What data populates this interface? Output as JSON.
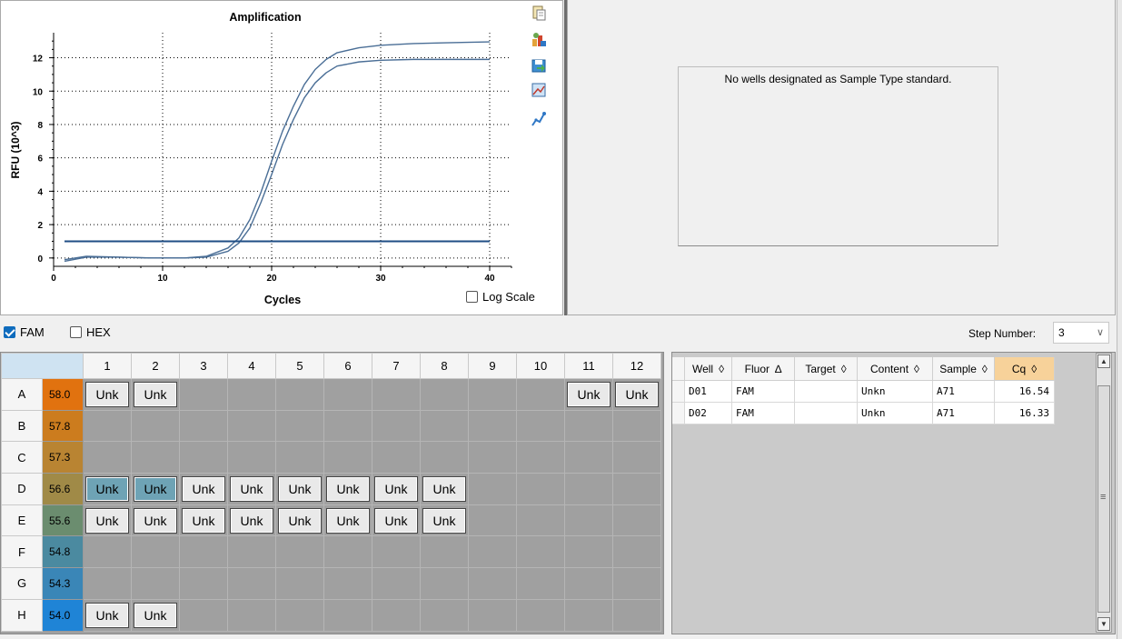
{
  "chart_data": {
    "type": "line",
    "title": "Amplification",
    "xlabel": "Cycles",
    "ylabel": "RFU (10^3)",
    "xlim": [
      0,
      42
    ],
    "ylim": [
      -0.5,
      13.5
    ],
    "xticks": [
      0,
      10,
      20,
      30,
      40
    ],
    "yticks": [
      0,
      2,
      4,
      6,
      8,
      10,
      12
    ],
    "grid": "dotted",
    "series": [
      {
        "values": [
          [
            1,
            -0.1
          ],
          [
            3,
            0.1
          ],
          [
            6,
            0.05
          ],
          [
            9,
            0.0
          ],
          [
            12,
            0.0
          ],
          [
            14,
            0.1
          ],
          [
            16,
            0.6
          ],
          [
            17,
            1.2
          ],
          [
            18,
            2.3
          ],
          [
            19,
            3.9
          ],
          [
            20,
            5.8
          ],
          [
            21,
            7.6
          ],
          [
            22,
            9.1
          ],
          [
            23,
            10.4
          ],
          [
            24,
            11.3
          ],
          [
            25,
            11.9
          ],
          [
            26,
            12.3
          ],
          [
            28,
            12.6
          ],
          [
            30,
            12.75
          ],
          [
            33,
            12.85
          ],
          [
            36,
            12.9
          ],
          [
            40,
            12.95
          ]
        ]
      },
      {
        "values": [
          [
            1,
            -0.2
          ],
          [
            3,
            0.05
          ],
          [
            6,
            0.05
          ],
          [
            9,
            0.0
          ],
          [
            12,
            0.0
          ],
          [
            14,
            0.05
          ],
          [
            16,
            0.4
          ],
          [
            17,
            0.9
          ],
          [
            18,
            1.8
          ],
          [
            19,
            3.3
          ],
          [
            20,
            5.0
          ],
          [
            21,
            6.8
          ],
          [
            22,
            8.3
          ],
          [
            23,
            9.6
          ],
          [
            24,
            10.5
          ],
          [
            25,
            11.1
          ],
          [
            26,
            11.5
          ],
          [
            28,
            11.75
          ],
          [
            30,
            11.85
          ],
          [
            33,
            11.9
          ],
          [
            36,
            11.9
          ],
          [
            40,
            11.9
          ]
        ]
      },
      {
        "values": [
          [
            1,
            1.0
          ],
          [
            40,
            1.0
          ]
        ]
      }
    ],
    "colors": {
      "curves": "#4a6e96",
      "threshold": "#1f4e85"
    }
  },
  "log_scale_label": "Log Scale",
  "standard_message": "No wells designated as Sample Type standard.",
  "fluors": [
    {
      "label": "FAM",
      "checked": true
    },
    {
      "label": "HEX",
      "checked": false
    }
  ],
  "step": {
    "label": "Step Number:",
    "value": "3"
  },
  "plate": {
    "columns": [
      "1",
      "2",
      "3",
      "4",
      "5",
      "6",
      "7",
      "8",
      "9",
      "10",
      "11",
      "12"
    ],
    "rows": [
      {
        "label": "A",
        "temp": "58.0",
        "color": "#e1720f",
        "wells": {
          "1": "Unk",
          "2": "Unk",
          "11": "Unk",
          "12": "Unk"
        }
      },
      {
        "label": "B",
        "temp": "57.8",
        "color": "#cc7c1e",
        "wells": {}
      },
      {
        "label": "C",
        "temp": "57.3",
        "color": "#b98432",
        "wells": {}
      },
      {
        "label": "D",
        "temp": "56.6",
        "color": "#a08a47",
        "wells": {
          "1": "Unk",
          "2": "Unk",
          "3": "Unk",
          "4": "Unk",
          "5": "Unk",
          "6": "Unk",
          "7": "Unk",
          "8": "Unk"
        },
        "selected": [
          "1",
          "2"
        ]
      },
      {
        "label": "E",
        "temp": "55.6",
        "color": "#6b8d6f",
        "wells": {
          "1": "Unk",
          "2": "Unk",
          "3": "Unk",
          "4": "Unk",
          "5": "Unk",
          "6": "Unk",
          "7": "Unk",
          "8": "Unk"
        }
      },
      {
        "label": "F",
        "temp": "54.8",
        "color": "#4b8aa0",
        "wells": {}
      },
      {
        "label": "G",
        "temp": "54.3",
        "color": "#3a86b7",
        "wells": {}
      },
      {
        "label": "H",
        "temp": "54.0",
        "color": "#1f84d6",
        "wells": {
          "1": "Unk",
          "2": "Unk"
        }
      }
    ]
  },
  "results": {
    "columns": [
      {
        "label": "Well",
        "sort": "◊"
      },
      {
        "label": "Fluor",
        "sort": "∆"
      },
      {
        "label": "Target",
        "sort": "◊"
      },
      {
        "label": "Content",
        "sort": "◊"
      },
      {
        "label": "Sample",
        "sort": "◊"
      },
      {
        "label": "Cq",
        "sort": "◊"
      }
    ],
    "rows": [
      [
        "D01",
        "FAM",
        "",
        "Unkn",
        "A71",
        "16.54"
      ],
      [
        "D02",
        "FAM",
        "",
        "Unkn",
        "A71",
        "16.33"
      ]
    ]
  },
  "toolbar_icons": [
    "copy-icon",
    "export-icon",
    "save-image-icon",
    "chart-options-icon",
    "curve-options-icon"
  ]
}
